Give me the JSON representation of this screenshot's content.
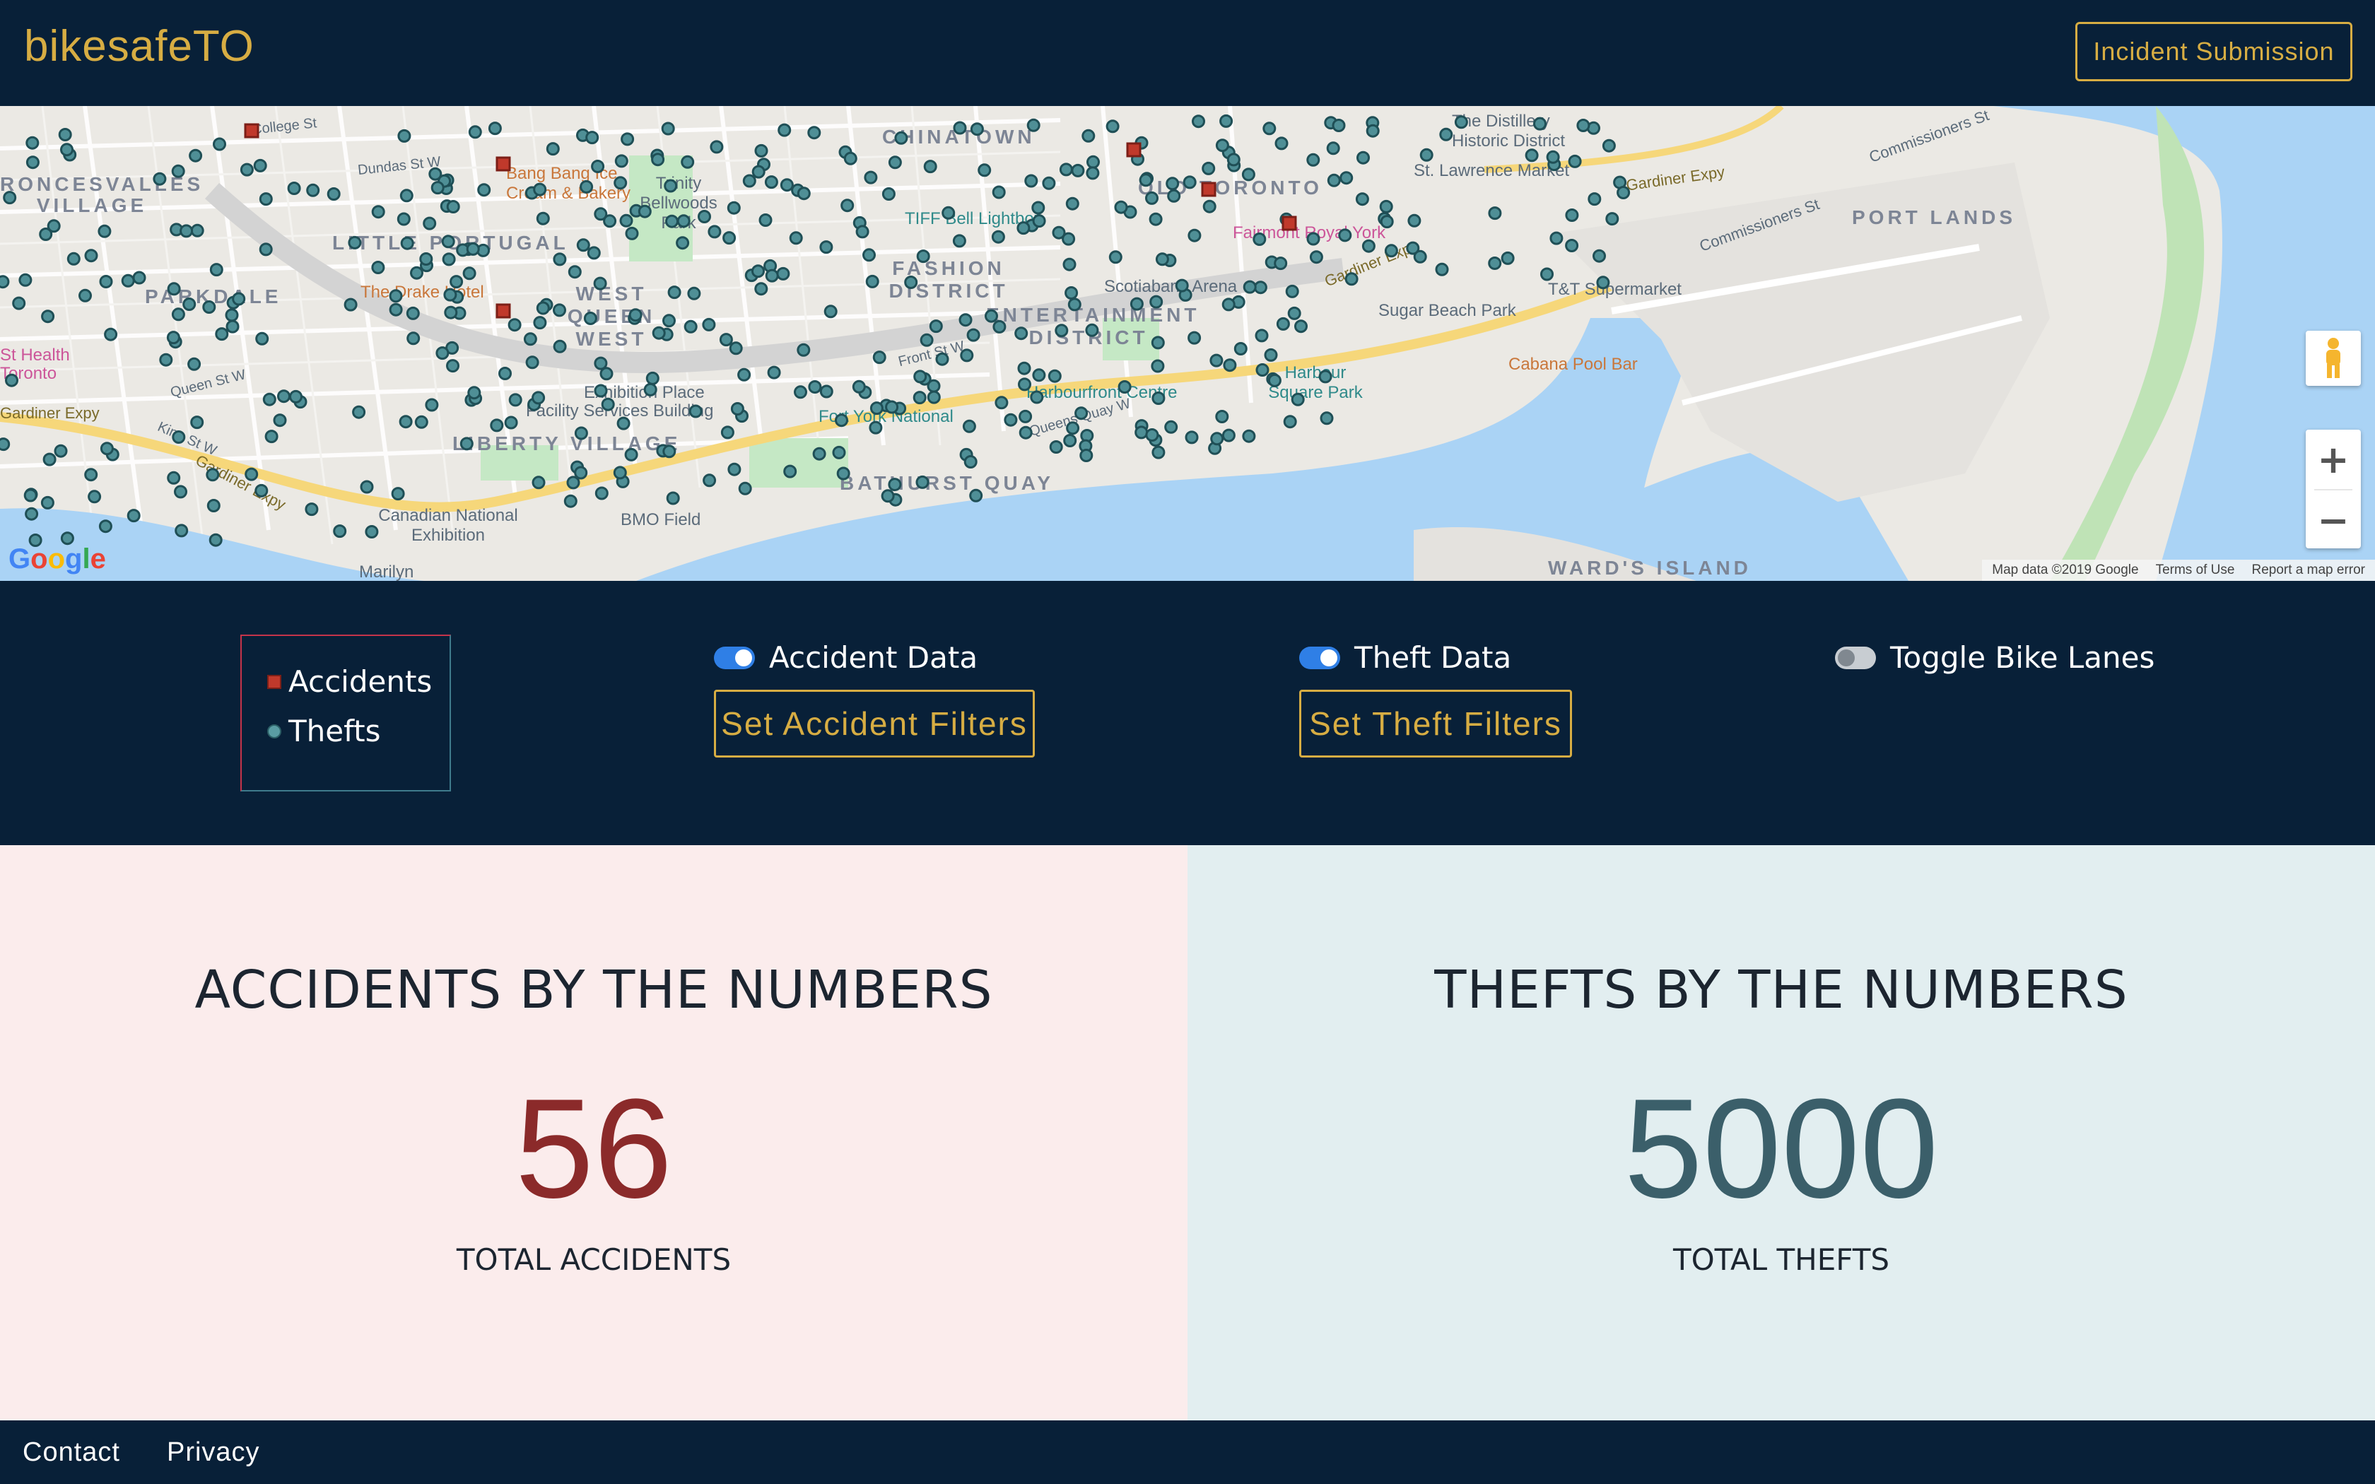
{
  "header": {
    "brand": "bikesafeTO",
    "submit_label": "Incident Submission"
  },
  "map": {
    "neighbourhoods": [
      "CHINATOWN",
      "LITTLE PORTUGAL",
      "WEST QUEEN WEST",
      "PARKDALE",
      "FASHION DISTRICT",
      "ENTERTAINMENT DISTRICT",
      "LIBERTY VILLAGE",
      "BATHURST QUAY",
      "PORT LANDS",
      "OLD TORONTO",
      "WARD'S ISLAND",
      "RONCESVALLES VILLAGE"
    ],
    "pois": [
      "Bang Bang Ice Cream & Bakery",
      "Trinity Bellwoods Park",
      "The Drake Hotel",
      "Exhibition Place",
      "Fort York National",
      "Canadian National Exhibition",
      "BMO Field",
      "Scotiabank Arena",
      "Fairmont Royal York",
      "TIFF Bell Lightbox",
      "Harbourfront Centre",
      "Harbour Square Park",
      "Sugar Beach Park",
      "T&T Supermarket",
      "Cabana Pool Bar",
      "The Distillery Historic District",
      "St. Lawrence Market",
      "Facility Services Building",
      "Marilyn",
      "St Health Toronto"
    ],
    "roads": [
      "Gardiner Expy",
      "Commissioners St",
      "Queen St W",
      "King St W",
      "Queens Quay W",
      "Front St W",
      "Dundas St W",
      "College St"
    ],
    "attribution": [
      "Map data ©2019 Google",
      "Terms of Use",
      "Report a map error"
    ],
    "google_letters": [
      "G",
      "o",
      "o",
      "g",
      "l",
      "e"
    ],
    "zoom_in": "+",
    "zoom_out": "−"
  },
  "legend": {
    "accidents": "Accidents",
    "thefts": "Thefts"
  },
  "toggles": {
    "accident": {
      "label": "Accident Data",
      "on": true,
      "filter_label": "Set Accident Filters"
    },
    "theft": {
      "label": "Theft Data",
      "on": true,
      "filter_label": "Set Theft Filters"
    },
    "bike_lanes": {
      "label": "Toggle Bike Lanes",
      "on": false
    }
  },
  "stats": {
    "accidents": {
      "title": "ACCIDENTS BY THE NUMBERS",
      "value": "56",
      "subtitle": "TOTAL ACCIDENTS"
    },
    "thefts": {
      "title": "THEFTS BY THE NUMBERS",
      "value": "5000",
      "subtitle": "TOTAL THEFTS"
    }
  },
  "footer": {
    "contact": "Contact",
    "privacy": "Privacy"
  },
  "colors": {
    "navy": "#082038",
    "gold": "#d7ad43",
    "accident_red": "#c0392b",
    "theft_teal": "#4f8f96",
    "water": "#aad3f5"
  }
}
